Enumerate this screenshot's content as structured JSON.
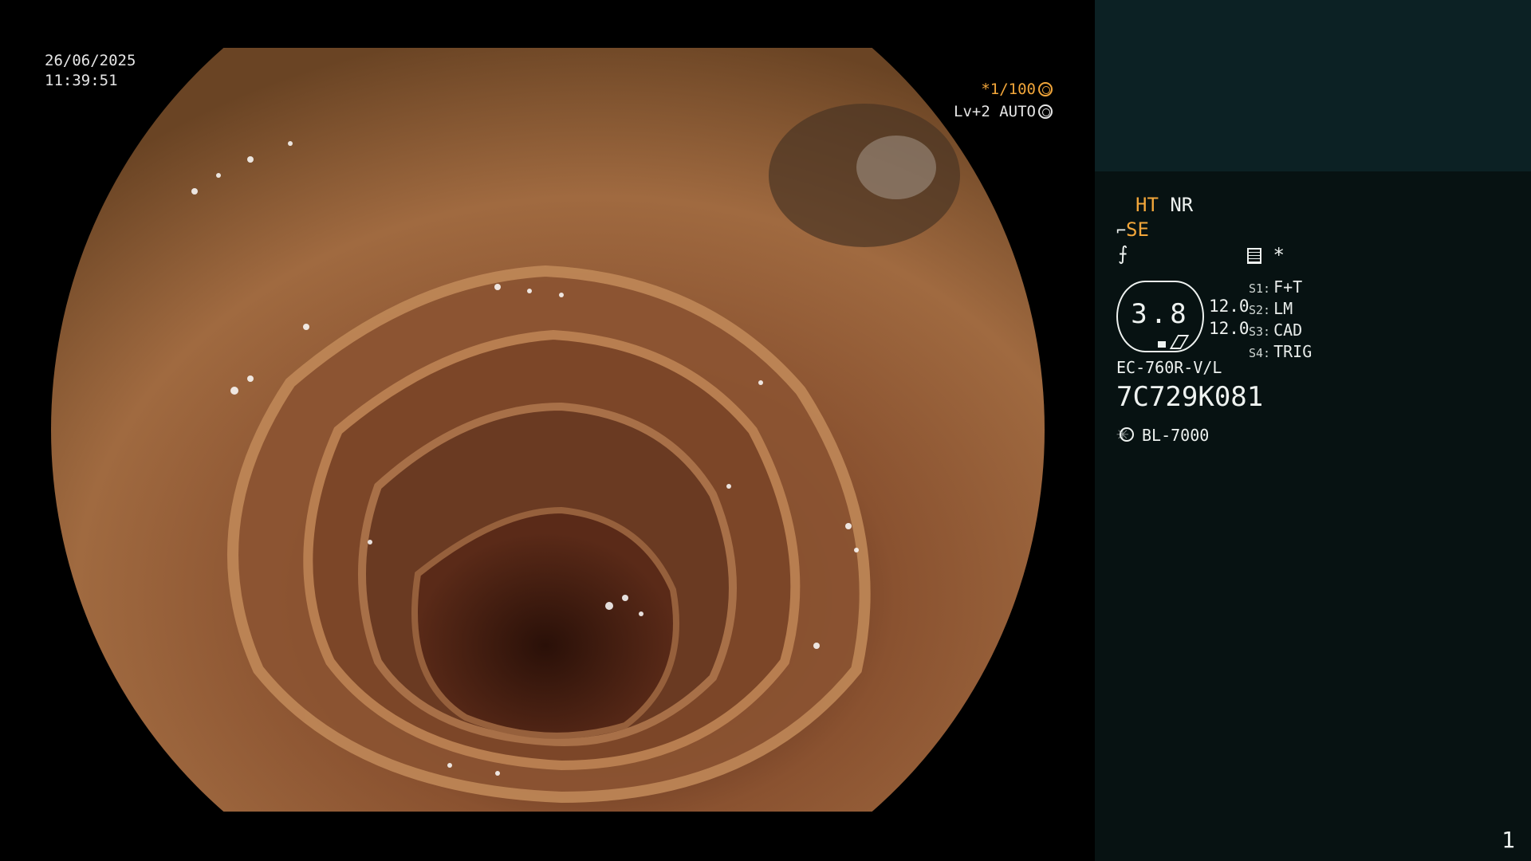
{
  "overlay": {
    "date": "26/06/2025",
    "time": "11:39:51",
    "shutter": "*1/100",
    "level": "Lv+2 AUTO"
  },
  "panel": {
    "ht": "HT",
    "nr": "NR",
    "se": "SE",
    "star": "*",
    "ratio": "3.8",
    "val1": "12.0",
    "val2": "12.0",
    "switches": [
      {
        "key": "S1:",
        "label": "F+T"
      },
      {
        "key": "S2:",
        "label": "LM"
      },
      {
        "key": "S3:",
        "label": "CAD"
      },
      {
        "key": "S4:",
        "label": "TRIG"
      }
    ],
    "scope_model": "EC-760R-V/L",
    "serial": "7C729K081",
    "light_source": "BL-7000",
    "page": "1"
  },
  "icons": [
    "shutter-icon",
    "auto-icon",
    "scope-icon",
    "enhance-icon",
    "doc-icon",
    "light-icon"
  ]
}
